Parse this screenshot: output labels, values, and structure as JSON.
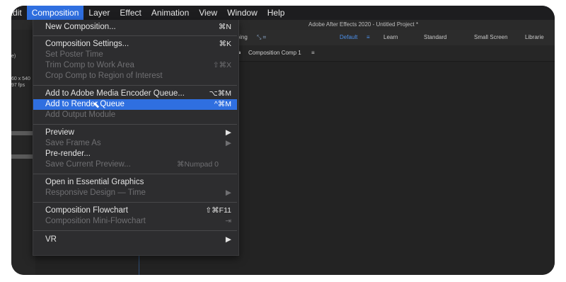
{
  "menubar": {
    "items": [
      "Edit",
      "Composition",
      "Layer",
      "Effect",
      "Animation",
      "View",
      "Window",
      "Help"
    ]
  },
  "window_title": "Adobe After Effects 2020 - Untitled Project *",
  "toolbar": {
    "snapping": "Snapping",
    "workspaces": [
      "Default",
      "Learn",
      "Standard",
      "Small Screen",
      "Librarie"
    ]
  },
  "panel": {
    "comp_tab": "Composition Comp 1"
  },
  "left_panel": {
    "frag1": "e)",
    "frag2": "60 x 540",
    "frag3": "97 fps"
  },
  "menu": {
    "new_composition": {
      "label": "New Composition...",
      "shortcut": "⌘N"
    },
    "composition_settings": {
      "label": "Composition Settings...",
      "shortcut": "⌘K"
    },
    "set_poster_time": {
      "label": "Set Poster Time"
    },
    "trim_comp": {
      "label": "Trim Comp to Work Area",
      "shortcut": "⇧⌘X"
    },
    "crop_comp": {
      "label": "Crop Comp to Region of Interest"
    },
    "add_media_encoder": {
      "label": "Add to Adobe Media Encoder Queue...",
      "shortcut": "⌥⌘M"
    },
    "add_render_queue": {
      "label": "Add to Render Queue",
      "shortcut": "^⌘M"
    },
    "add_output_module": {
      "label": "Add Output Module"
    },
    "preview": {
      "label": "Preview",
      "shortcut": "▶"
    },
    "save_frame_as": {
      "label": "Save Frame As",
      "shortcut": "▶"
    },
    "pre_render": {
      "label": "Pre-render..."
    },
    "save_current_preview": {
      "label": "Save Current Preview...",
      "shortcut": "⌘Numpad 0"
    },
    "open_essential_graphics": {
      "label": "Open in Essential Graphics"
    },
    "responsive_design": {
      "label": "Responsive Design — Time",
      "shortcut": "▶"
    },
    "composition_flowchart": {
      "label": "Composition Flowchart",
      "shortcut": "⇧⌘F11"
    },
    "composition_mini_flowchart": {
      "label": "Composition Mini-Flowchart",
      "shortcut": "⇥"
    },
    "vr": {
      "label": "VR",
      "shortcut": "▶"
    }
  },
  "colors": {
    "highlight": "#2f6fe0",
    "menu_bg": "#2d2d2f",
    "disabled_text": "#6f6f72"
  }
}
